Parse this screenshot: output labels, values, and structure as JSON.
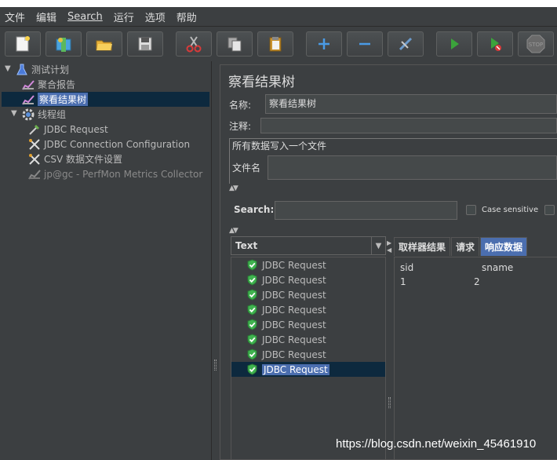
{
  "menu": {
    "items": [
      "文件",
      "编辑",
      "Search",
      "运行",
      "选项",
      "帮助"
    ]
  },
  "toolbar": {
    "buttons": [
      "new-icon",
      "templates-icon",
      "open-icon",
      "save-icon",
      "cut-icon",
      "copy-icon",
      "paste-icon",
      "expand-icon",
      "collapse-icon",
      "toggle-icon",
      "start-icon",
      "start-no-pause-icon",
      "stop-icon"
    ],
    "stop_label": "STOP"
  },
  "tree": {
    "test_plan": "测试计划",
    "aggregate_report": "聚合报告",
    "view_results_tree": "察看结果树",
    "thread_group": "线程组",
    "jdbc_request": "JDBC Request",
    "jdbc_connection": "JDBC Connection Configuration",
    "csv_config": "CSV 数据文件设置",
    "perfmon": "jp@gc - PerfMon Metrics Collector"
  },
  "panel": {
    "title": "察看结果树",
    "name_label": "名称:",
    "name_value": "察看结果树",
    "comment_label": "注释:",
    "comment_value": "",
    "group_legend": "所有数据写入一个文件",
    "filename_label": "文件名",
    "filename_value": "",
    "search_label": "Search:",
    "search_value": "",
    "case_sensitive": "Case sensitive"
  },
  "renderer": {
    "selected": "Text"
  },
  "samples": [
    "JDBC Request",
    "JDBC Request",
    "JDBC Request",
    "JDBC Request",
    "JDBC Request",
    "JDBC Request",
    "JDBC Request",
    "JDBC Request"
  ],
  "tabs": [
    "取样器结果",
    "请求",
    "响应数据"
  ],
  "response": {
    "headers": [
      "sid",
      "sname"
    ],
    "row": [
      "1",
      "2"
    ]
  },
  "watermark": "https://blog.csdn.net/weixin_45461910",
  "colors": {
    "background": "#3c3f41",
    "selection": "#4b6eaf",
    "success": "#3fb34f"
  }
}
